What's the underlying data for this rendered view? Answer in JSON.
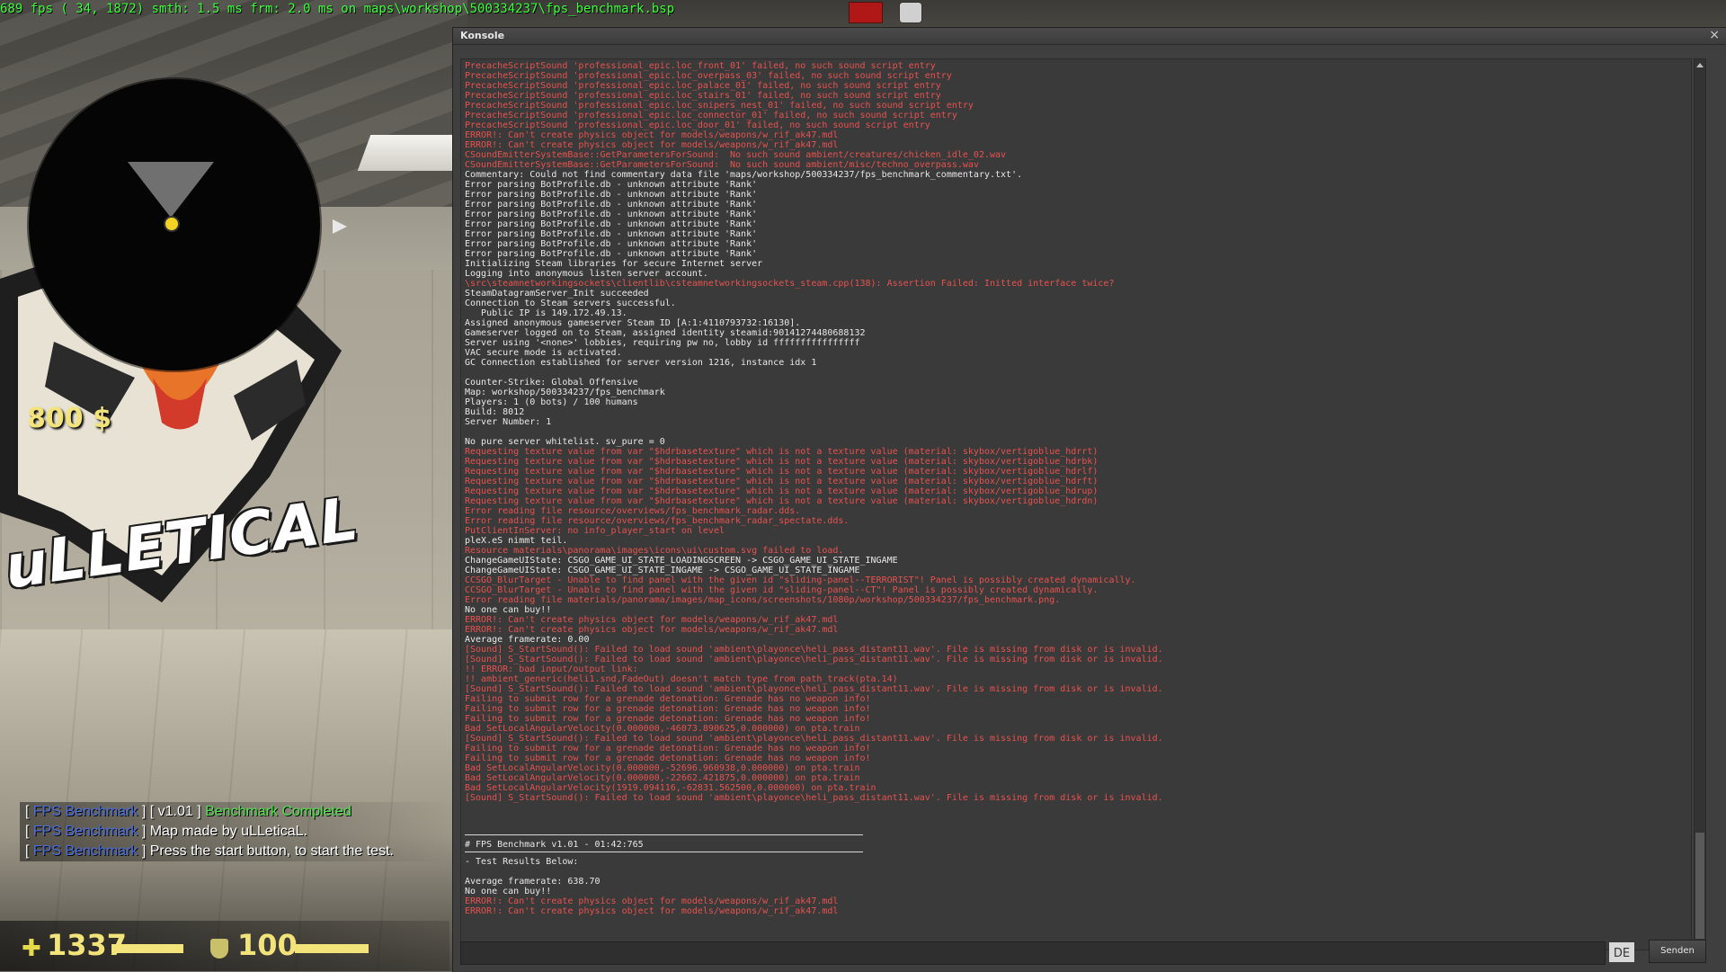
{
  "overlay": {
    "fps_line": "689 fps ( 34, 1872) smth: 1.5 ms frm: 2.0 ms on maps\\workshop\\500334237\\fps_benchmark.bsp"
  },
  "hud": {
    "money": "800 $",
    "health": "1337",
    "armor": "100",
    "logo_text": "uLLETICAL"
  },
  "chat": [
    {
      "tag": "FPS Benchmark",
      "extra": "v1.01",
      "msg": "Benchmark Completed",
      "msg_color": "green"
    },
    {
      "tag": "FPS Benchmark",
      "extra": "",
      "msg": "Map made by uLLeticaL.",
      "msg_color": "white"
    },
    {
      "tag": "FPS Benchmark",
      "extra": "",
      "msg": "Press the start button, to start the test.",
      "msg_color": "white"
    }
  ],
  "console": {
    "title": "Konsole",
    "close_icon": "×",
    "send_label": "Senden",
    "language": "DE",
    "input_value": "",
    "colors": {
      "error": "#e6524f",
      "normal": "#e8e8e8"
    },
    "lines": [
      {
        "t": "PrecacheScriptSound 'professional_epic.loc_front_01' failed, no such sound script entry",
        "c": "err"
      },
      {
        "t": "PrecacheScriptSound 'professional_epic.loc_overpass_03' failed, no such sound script entry",
        "c": "err"
      },
      {
        "t": "PrecacheScriptSound 'professional_epic.loc_palace_01' failed, no such sound script entry",
        "c": "err"
      },
      {
        "t": "PrecacheScriptSound 'professional_epic.loc_stairs_01' failed, no such sound script entry",
        "c": "err"
      },
      {
        "t": "PrecacheScriptSound 'professional_epic.loc_snipers_nest_01' failed, no such sound script entry",
        "c": "err"
      },
      {
        "t": "PrecacheScriptSound 'professional_epic.loc_connector_01' failed, no such sound script entry",
        "c": "err"
      },
      {
        "t": "PrecacheScriptSound 'professional_epic.loc_door_01' failed, no such sound script entry",
        "c": "err"
      },
      {
        "t": "ERROR!: Can't create physics object for models/weapons/w_rif_ak47.mdl",
        "c": "err"
      },
      {
        "t": "ERROR!: Can't create physics object for models/weapons/w_rif_ak47.mdl",
        "c": "err"
      },
      {
        "t": "CSoundEmitterSystemBase::GetParametersForSound:  No such sound ambient/creatures/chicken_idle_02.wav",
        "c": "err"
      },
      {
        "t": "CSoundEmitterSystemBase::GetParametersForSound:  No such sound ambient/misc/techno_overpass.wav",
        "c": "err"
      },
      {
        "t": "Commentary: Could not find commentary data file 'maps/workshop/500334237/fps_benchmark_commentary.txt'.",
        "c": "n"
      },
      {
        "t": "Error parsing BotProfile.db - unknown attribute 'Rank'",
        "c": "n"
      },
      {
        "t": "Error parsing BotProfile.db - unknown attribute 'Rank'",
        "c": "n"
      },
      {
        "t": "Error parsing BotProfile.db - unknown attribute 'Rank'",
        "c": "n"
      },
      {
        "t": "Error parsing BotProfile.db - unknown attribute 'Rank'",
        "c": "n"
      },
      {
        "t": "Error parsing BotProfile.db - unknown attribute 'Rank'",
        "c": "n"
      },
      {
        "t": "Error parsing BotProfile.db - unknown attribute 'Rank'",
        "c": "n"
      },
      {
        "t": "Error parsing BotProfile.db - unknown attribute 'Rank'",
        "c": "n"
      },
      {
        "t": "Error parsing BotProfile.db - unknown attribute 'Rank'",
        "c": "n"
      },
      {
        "t": "Initializing Steam libraries for secure Internet server",
        "c": "n"
      },
      {
        "t": "Logging into anonymous listen server account.",
        "c": "n"
      },
      {
        "t": "\\src\\steamnetworkingsockets\\clientlib\\csteamnetworkingsockets_steam.cpp(138): Assertion Failed: Initted interface twice?",
        "c": "err"
      },
      {
        "t": "SteamDatagramServer_Init succeeded",
        "c": "n"
      },
      {
        "t": "Connection to Steam servers successful.",
        "c": "n"
      },
      {
        "t": "   Public IP is 149.172.49.13.",
        "c": "n"
      },
      {
        "t": "Assigned anonymous gameserver Steam ID [A:1:4110793732:16130].",
        "c": "n"
      },
      {
        "t": "Gameserver logged on to Steam, assigned identity steamid:90141274480688132",
        "c": "n"
      },
      {
        "t": "Server using '<none>' lobbies, requiring pw no, lobby id ffffffffffffffff",
        "c": "n"
      },
      {
        "t": "VAC secure mode is activated.",
        "c": "n"
      },
      {
        "t": "GC Connection established for server version 1216, instance idx 1",
        "c": "n"
      },
      {
        "t": "",
        "c": "n"
      },
      {
        "t": "Counter-Strike: Global Offensive",
        "c": "n"
      },
      {
        "t": "Map: workshop/500334237/fps_benchmark",
        "c": "n"
      },
      {
        "t": "Players: 1 (0 bots) / 100 humans",
        "c": "n"
      },
      {
        "t": "Build: 8012",
        "c": "n"
      },
      {
        "t": "Server Number: 1",
        "c": "n"
      },
      {
        "t": "",
        "c": "n"
      },
      {
        "t": "No pure server whitelist. sv_pure = 0",
        "c": "n"
      },
      {
        "t": "Requesting texture value from var \"$hdrbasetexture\" which is not a texture value (material: skybox/vertigoblue_hdrrt)",
        "c": "err"
      },
      {
        "t": "Requesting texture value from var \"$hdrbasetexture\" which is not a texture value (material: skybox/vertigoblue_hdrbk)",
        "c": "err"
      },
      {
        "t": "Requesting texture value from var \"$hdrbasetexture\" which is not a texture value (material: skybox/vertigoblue_hdrlf)",
        "c": "err"
      },
      {
        "t": "Requesting texture value from var \"$hdrbasetexture\" which is not a texture value (material: skybox/vertigoblue_hdrft)",
        "c": "err"
      },
      {
        "t": "Requesting texture value from var \"$hdrbasetexture\" which is not a texture value (material: skybox/vertigoblue_hdrup)",
        "c": "err"
      },
      {
        "t": "Requesting texture value from var \"$hdrbasetexture\" which is not a texture value (material: skybox/vertigoblue_hdrdn)",
        "c": "err"
      },
      {
        "t": "Error reading file resource/overviews/fps_benchmark_radar.dds.",
        "c": "err"
      },
      {
        "t": "Error reading file resource/overviews/fps_benchmark_radar_spectate.dds.",
        "c": "err"
      },
      {
        "t": "PutClientInServer: no info_player_start on level",
        "c": "err"
      },
      {
        "t": "pleX.eS nimmt teil.",
        "c": "n"
      },
      {
        "t": "Resource materials\\panorama\\images\\icons\\ui\\custom.svg failed to load.",
        "c": "err"
      },
      {
        "t": "ChangeGameUIState: CSGO_GAME_UI_STATE_LOADINGSCREEN -> CSGO_GAME_UI_STATE_INGAME",
        "c": "n"
      },
      {
        "t": "ChangeGameUIState: CSGO_GAME_UI_STATE_INGAME -> CSGO_GAME_UI_STATE_INGAME",
        "c": "n"
      },
      {
        "t": "CCSGO_BlurTarget - Unable to find panel with the given id \"sliding-panel--TERRORIST\"! Panel is possibly created dynamically.",
        "c": "err"
      },
      {
        "t": "CCSGO_BlurTarget - Unable to find panel with the given id \"sliding-panel--CT\"! Panel is possibly created dynamically.",
        "c": "err"
      },
      {
        "t": "Error reading file materials/panorama/images/map_icons/screenshots/1080p/workshop/500334237/fps_benchmark.png.",
        "c": "err"
      },
      {
        "t": "No one can buy!!",
        "c": "n"
      },
      {
        "t": "ERROR!: Can't create physics object for models/weapons/w_rif_ak47.mdl",
        "c": "err"
      },
      {
        "t": "ERROR!: Can't create physics object for models/weapons/w_rif_ak47.mdl",
        "c": "err"
      },
      {
        "t": "Average framerate: 0.00",
        "c": "n"
      },
      {
        "t": "[Sound] S_StartSound(): Failed to load sound 'ambient\\playonce\\heli_pass_distant11.wav'. File is missing from disk or is invalid.",
        "c": "err"
      },
      {
        "t": "[Sound] S_StartSound(): Failed to load sound 'ambient\\playonce\\heli_pass_distant11.wav'. File is missing from disk or is invalid.",
        "c": "err"
      },
      {
        "t": "!! ERROR: bad input/output link:",
        "c": "err"
      },
      {
        "t": "!! ambient_generic(heli1.snd,FadeOut) doesn't match type from path_track(pta.14)",
        "c": "err"
      },
      {
        "t": "[Sound] S_StartSound(): Failed to load sound 'ambient\\playonce\\heli_pass_distant11.wav'. File is missing from disk or is invalid.",
        "c": "err"
      },
      {
        "t": "Failing to submit row for a grenade detonation: Grenade has no weapon info!",
        "c": "err"
      },
      {
        "t": "Failing to submit row for a grenade detonation: Grenade has no weapon info!",
        "c": "err"
      },
      {
        "t": "Failing to submit row for a grenade detonation: Grenade has no weapon info!",
        "c": "err"
      },
      {
        "t": "Bad SetLocalAngularVelocity(0.000000,-46073.890625,0.000000) on pta.train",
        "c": "err"
      },
      {
        "t": "[Sound] S_StartSound(): Failed to load sound 'ambient\\playonce\\heli_pass_distant11.wav'. File is missing from disk or is invalid.",
        "c": "err"
      },
      {
        "t": "Failing to submit row for a grenade detonation: Grenade has no weapon info!",
        "c": "err"
      },
      {
        "t": "Failing to submit row for a grenade detonation: Grenade has no weapon info!",
        "c": "err"
      },
      {
        "t": "Bad SetLocalAngularVelocity(0.000000,-52696.960938,0.000000) on pta.train",
        "c": "err"
      },
      {
        "t": "Bad SetLocalAngularVelocity(0.000000,-22662.421875,0.000000) on pta.train",
        "c": "err"
      },
      {
        "t": "Bad SetLocalAngularVelocity(1919.094116,-62831.562500,0.000000) on pta.train",
        "c": "err"
      },
      {
        "t": "[Sound] S_StartSound(): Failed to load sound 'ambient\\playonce\\heli_pass_distant11.wav'. File is missing from disk or is invalid.",
        "c": "err"
      },
      {
        "t": "",
        "c": "n"
      },
      {
        "t": "",
        "c": "n"
      },
      {
        "t": "",
        "c": "n"
      },
      {
        "t": "",
        "c": "sep"
      },
      {
        "t": "# FPS Benchmark v1.01 - 01:42:765",
        "c": "n"
      },
      {
        "t": "",
        "c": "sep"
      },
      {
        "t": "- Test Results Below:",
        "c": "n"
      },
      {
        "t": "",
        "c": "n"
      },
      {
        "t": "Average framerate: 638.70",
        "c": "n"
      },
      {
        "t": "No one can buy!!",
        "c": "n"
      },
      {
        "t": "ERROR!: Can't create physics object for models/weapons/w_rif_ak47.mdl",
        "c": "err"
      },
      {
        "t": "ERROR!: Can't create physics object for models/weapons/w_rif_ak47.mdl",
        "c": "err"
      }
    ]
  }
}
